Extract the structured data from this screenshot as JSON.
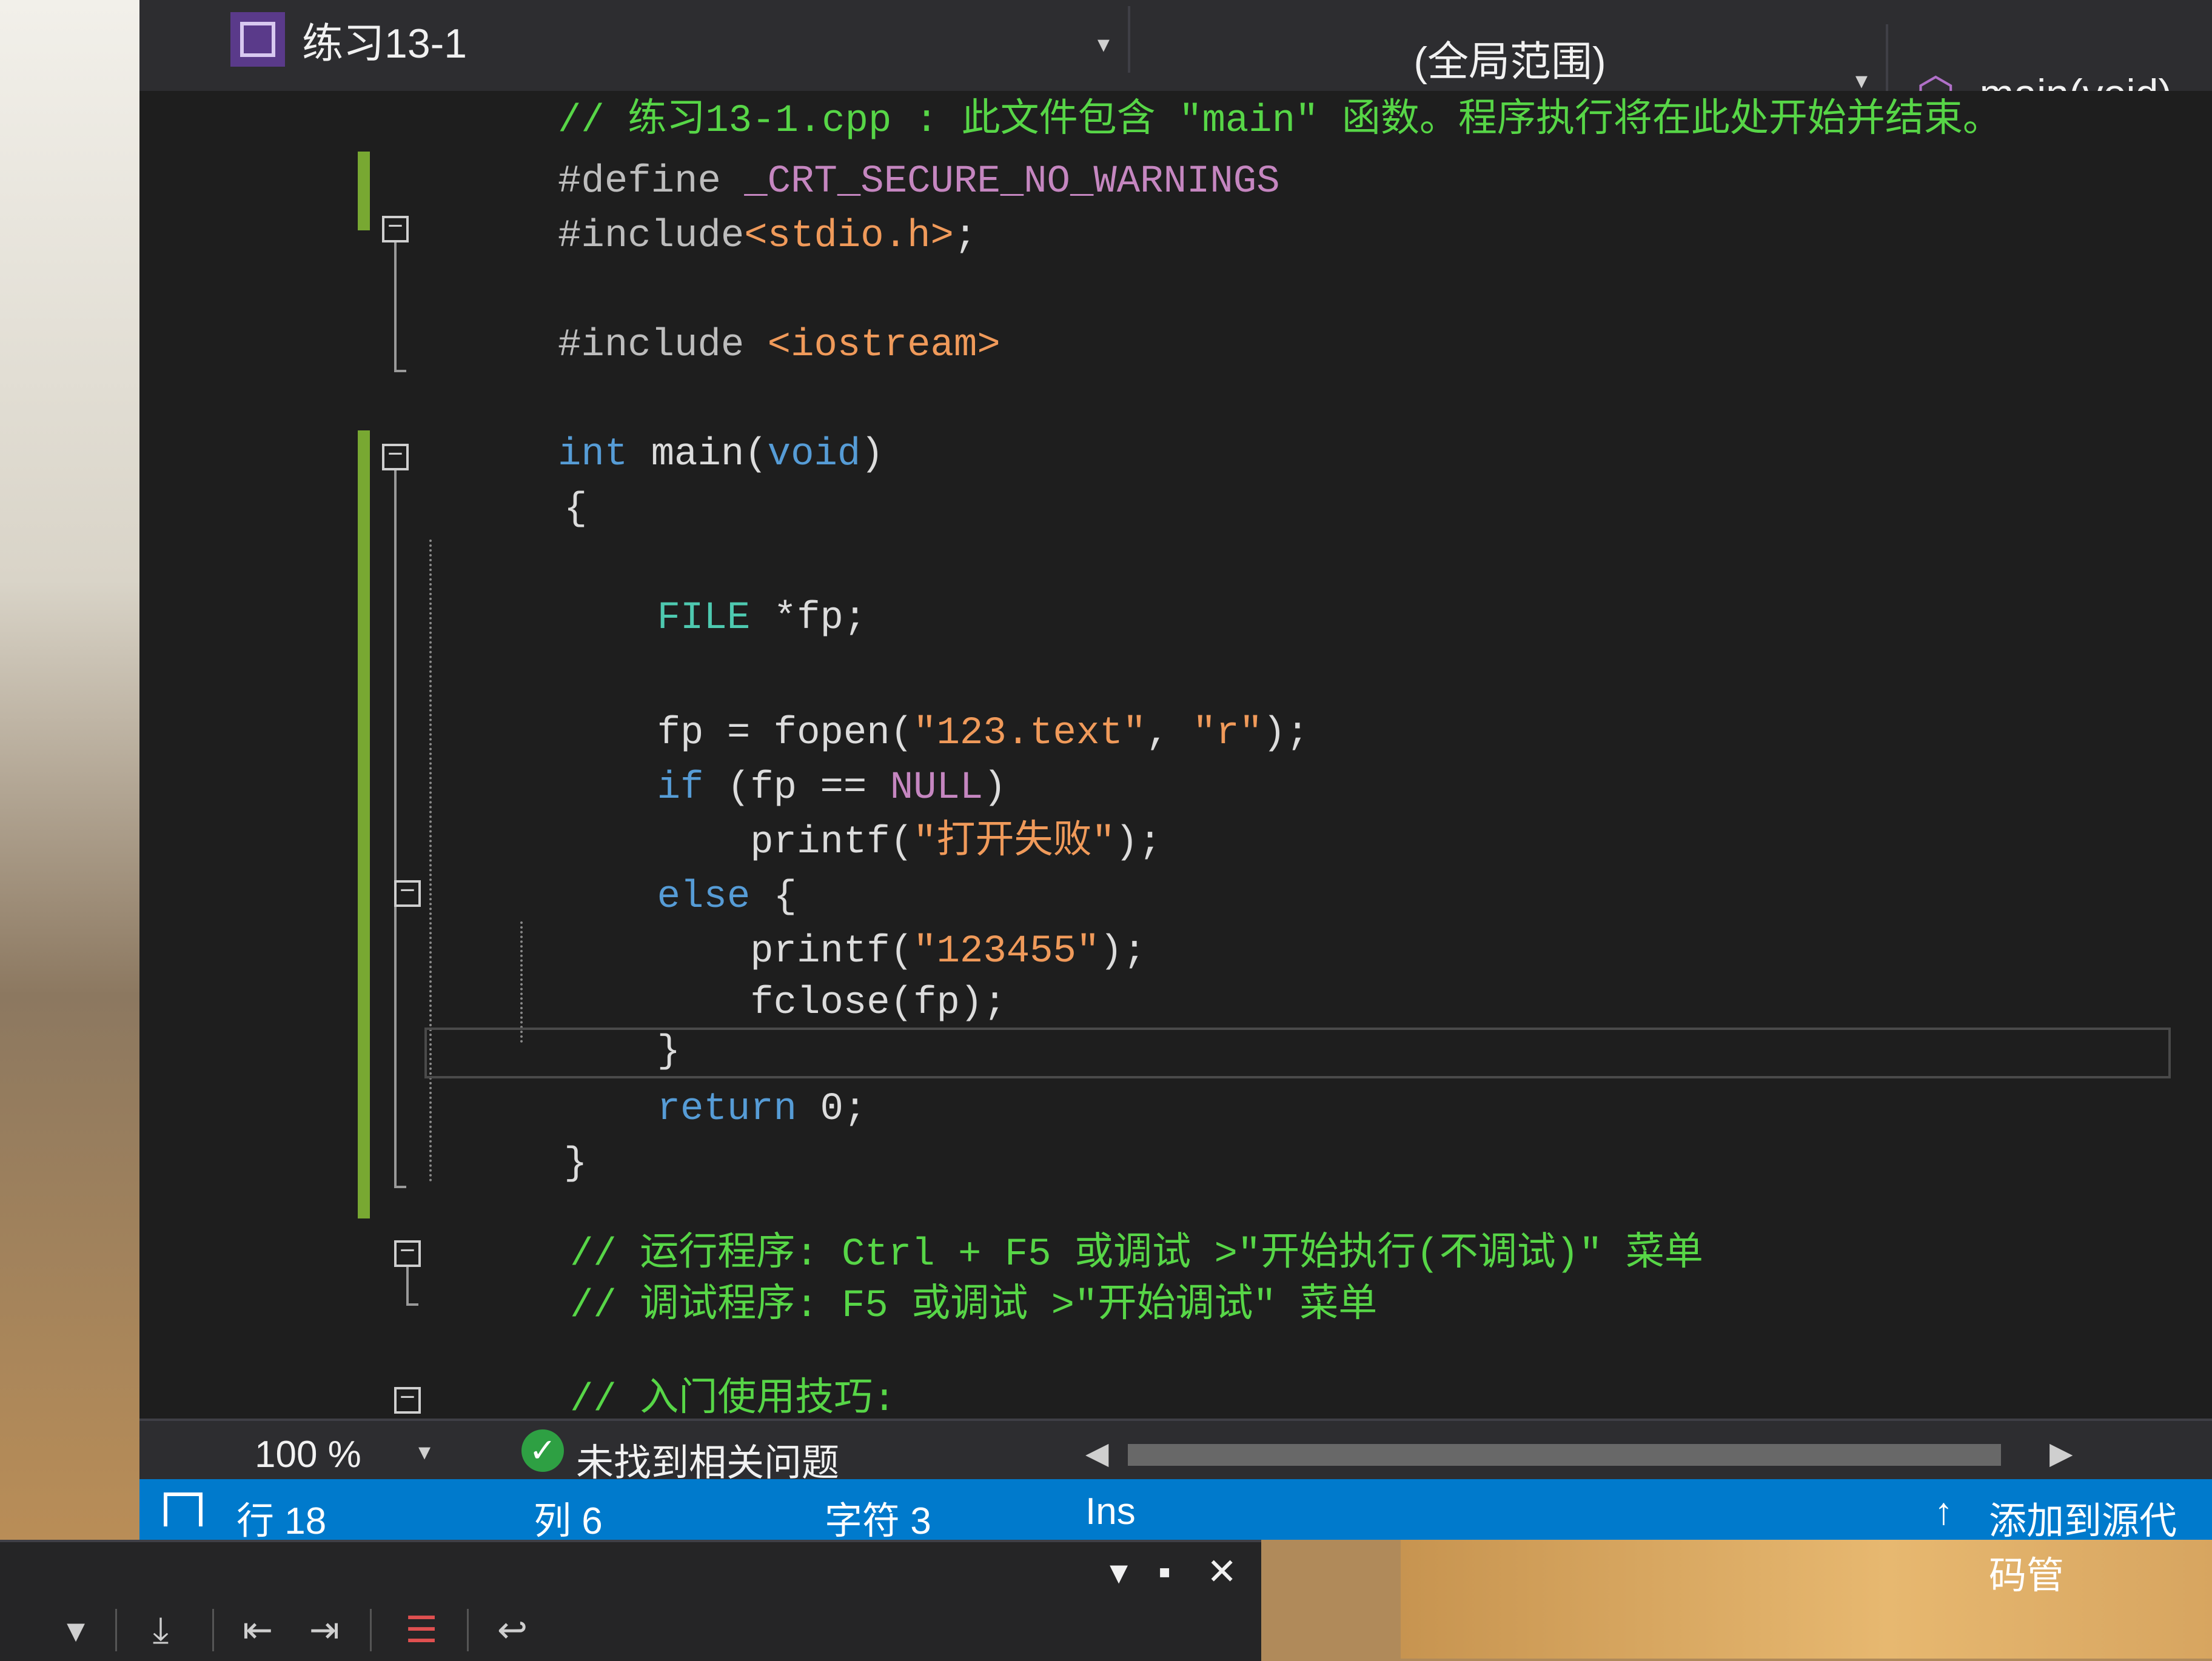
{
  "navbar": {
    "file": "练习13-1",
    "scope": "(全局范围)",
    "function": "main(void)"
  },
  "code_lines": [
    {
      "parts": [
        {
          "t": "// 练习13-1.cpp : 此文件包含 \"main\" 函数。程序执行将在此处开始并结束。",
          "c": "c-comment"
        }
      ]
    },
    {
      "parts": [
        {
          "t": "#define ",
          "c": "c-prep"
        },
        {
          "t": "_CRT_SECURE_NO_WARNINGS",
          "c": "c-macro"
        }
      ]
    },
    {
      "parts": [
        {
          "t": "#include",
          "c": "c-prep"
        },
        {
          "t": "<stdio.h>",
          "c": "c-str"
        },
        {
          "t": ";",
          "c": "c-plain"
        }
      ]
    },
    {
      "parts": [
        {
          "t": "#include ",
          "c": "c-prep"
        },
        {
          "t": "<iostream>",
          "c": "c-str"
        }
      ]
    },
    {
      "parts": [
        {
          "t": "int",
          "c": "c-kw"
        },
        {
          "t": " main(",
          "c": "c-plain"
        },
        {
          "t": "void",
          "c": "c-kw"
        },
        {
          "t": ")",
          "c": "c-plain"
        }
      ]
    },
    {
      "parts": [
        {
          "t": "{",
          "c": "c-plain"
        }
      ]
    },
    {
      "parts": [
        {
          "t": "    FILE",
          "c": "c-type"
        },
        {
          "t": " *fp;",
          "c": "c-plain"
        }
      ]
    },
    {
      "parts": [
        {
          "t": "    fp = fopen(",
          "c": "c-plain"
        },
        {
          "t": "\"123.text\"",
          "c": "c-str"
        },
        {
          "t": ", ",
          "c": "c-plain"
        },
        {
          "t": "\"r\"",
          "c": "c-str"
        },
        {
          "t": ");",
          "c": "c-plain"
        }
      ]
    },
    {
      "parts": [
        {
          "t": "    if",
          "c": "c-kw"
        },
        {
          "t": " (fp == ",
          "c": "c-plain"
        },
        {
          "t": "NULL",
          "c": "c-macro"
        },
        {
          "t": ")",
          "c": "c-plain"
        }
      ]
    },
    {
      "parts": [
        {
          "t": "        printf(",
          "c": "c-plain"
        },
        {
          "t": "\"打开失败\"",
          "c": "c-str"
        },
        {
          "t": ");",
          "c": "c-plain"
        }
      ]
    },
    {
      "parts": [
        {
          "t": "    else",
          "c": "c-kw"
        },
        {
          "t": " {",
          "c": "c-plain"
        }
      ]
    },
    {
      "parts": [
        {
          "t": "        printf(",
          "c": "c-plain"
        },
        {
          "t": "\"123455\"",
          "c": "c-str"
        },
        {
          "t": ");",
          "c": "c-plain"
        }
      ]
    },
    {
      "parts": [
        {
          "t": "        fclose(fp);",
          "c": "c-plain"
        }
      ]
    },
    {
      "parts": [
        {
          "t": "    }",
          "c": "c-plain"
        }
      ]
    },
    {
      "parts": [
        {
          "t": "    return",
          "c": "c-kw"
        },
        {
          "t": " 0;",
          "c": "c-plain"
        }
      ]
    },
    {
      "parts": [
        {
          "t": "}",
          "c": "c-plain"
        }
      ]
    },
    {
      "parts": [
        {
          "t": "// 运行程序: Ctrl + F5 或调试 >\"开始执行(不调试)\" 菜单",
          "c": "c-comment"
        }
      ]
    },
    {
      "parts": [
        {
          "t": "// 调试程序: F5 或调试 >\"开始调试\" 菜单",
          "c": "c-comment"
        }
      ]
    },
    {
      "parts": [
        {
          "t": "// 入门使用技巧:",
          "c": "c-comment"
        }
      ]
    }
  ],
  "editor_bar": {
    "zoom": "100 %",
    "issues": "未找到相关问题"
  },
  "status_bar": {
    "line": "行 18",
    "col": "列 6",
    "char": "字符 3",
    "mode": "Ins",
    "source_control": "添加到源代码管"
  },
  "lower_panel": {
    "dropdown": "▾",
    "maximize": "▪",
    "close": "✕"
  },
  "icons": {
    "file": "project-file-icon",
    "cube": "cube-icon",
    "check": "check-icon",
    "up_arrow": "up-arrow-icon"
  },
  "colors": {
    "comment": "#57d647",
    "keyword": "#569cd6",
    "macro": "#c586c0",
    "string": "#f09a5a",
    "status_bar": "#007acc",
    "change_bar": "#78a832"
  }
}
